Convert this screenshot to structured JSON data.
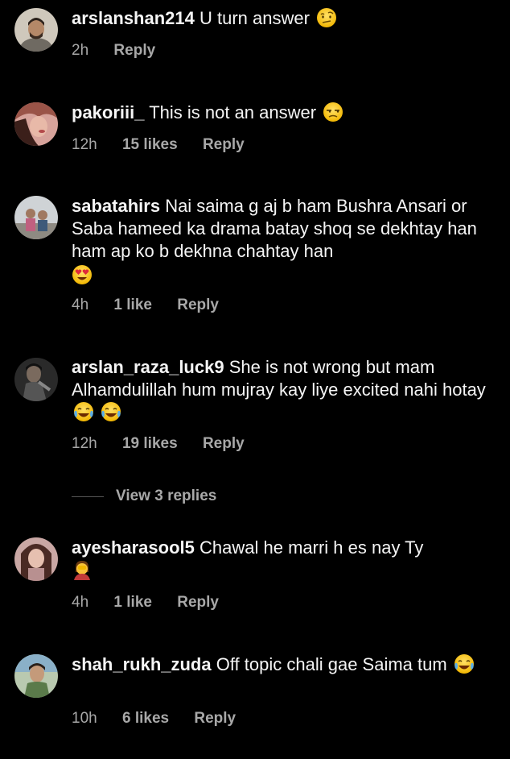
{
  "colors": {
    "background": "#000000",
    "primary_text": "#f5f5f5",
    "secondary_text": "#a8a8a8"
  },
  "comments": [
    {
      "username": "arslanshan214",
      "text": "U turn  answer",
      "emoji": "raised-eyebrow-face",
      "time": "2h",
      "likes": "",
      "reply": "Reply"
    },
    {
      "username": "pakoriii_",
      "text": "This is not an answer",
      "emoji": "unamused-face",
      "time": "12h",
      "likes": "15 likes",
      "reply": "Reply"
    },
    {
      "username": "sabatahirs",
      "text": "Nai saima g aj b ham Bushra Ansari or Saba hameed ka drama batay shoq se dekhtay han ham ap ko b dekhna chahtay han",
      "emoji": "heart-eyes-face",
      "time": "4h",
      "likes": "1 like",
      "reply": "Reply"
    },
    {
      "username": "arslan_raza_luck9",
      "text": "She is not wrong but mam Alhamdulillah hum mujray kay liye excited nahi hotay",
      "emoji": "tears-of-joy-face x2",
      "time": "12h",
      "likes": "19 likes",
      "reply": "Reply",
      "view_replies": "View 3 replies"
    },
    {
      "username": "ayesharasool5",
      "text": "Chawal he marri h es nay Ty",
      "emoji": "facepalm",
      "time": "4h",
      "likes": "1 like",
      "reply": "Reply"
    },
    {
      "username": "shah_rukh_zuda",
      "text": "Off topic chali gae Saima tum",
      "emoji": "tears-of-joy-face",
      "time": "10h",
      "likes": "6 likes",
      "reply": "Reply"
    }
  ]
}
